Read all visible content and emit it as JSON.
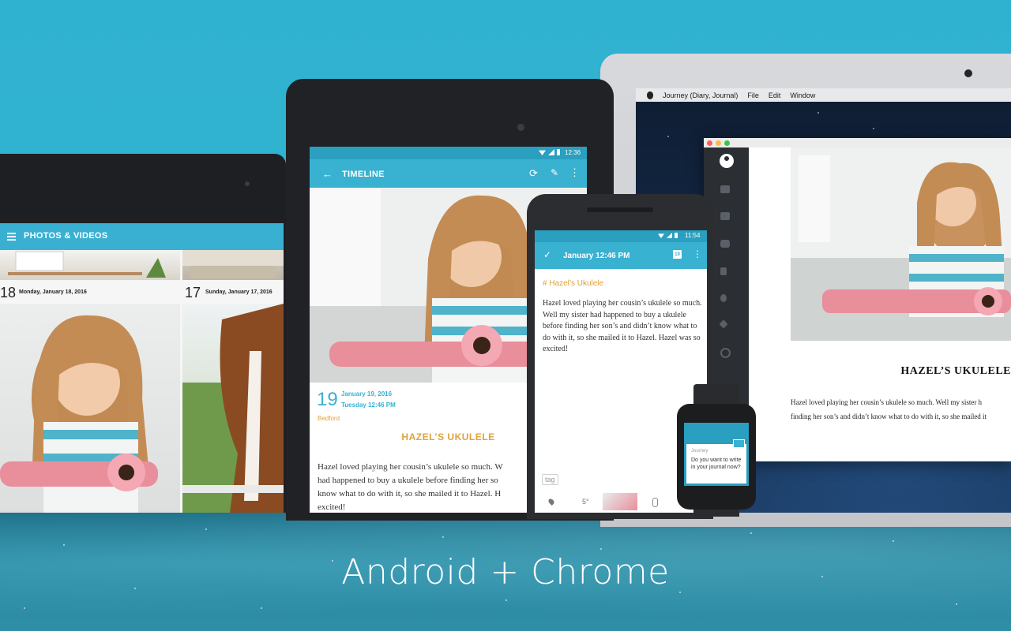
{
  "caption": "Android + Chrome",
  "colors": {
    "accent": "#39b1d1",
    "title_orange": "#e0a23a",
    "background": "#2fb0cf"
  },
  "mac": {
    "menu": [
      "Journey (Diary, Journal)",
      "File",
      "Edit",
      "Window"
    ],
    "sidebar_icons": [
      "profile-icon",
      "folder-icon",
      "calendar-icon",
      "camera-icon",
      "flag-icon",
      "bulb-icon",
      "tag-icon",
      "search-icon"
    ],
    "entry_title": "HAZEL’S UKULELE",
    "entry_body_line1": "Hazel loved playing her cousin’s ukulele so much. Well my sister h",
    "entry_body_line2": "finding her son’s and didn’t know what to do with it, so she mailed it"
  },
  "left_tablet": {
    "title": "PHOTOS & VIDEOS",
    "day1_num": "18",
    "day1_label": "Monday, January 18, 2016",
    "day2_num": "17",
    "day2_label": "Sunday, January 17, 2016"
  },
  "mid_tablet": {
    "time": "12:36",
    "title": "TIMELINE",
    "day_num": "19",
    "date_line1": "January 19, 2016",
    "date_line2": "Tuesday 12:46 PM",
    "place": "Bedford",
    "entry_title": "HAZEL’S UKULELE",
    "body_lines": [
      "Hazel loved playing her cousin’s ukulele so much. W",
      "had happened to buy a ukulele before finding her so",
      "know what to do with it, so she mailed it to Hazel. H",
      "excited!"
    ]
  },
  "phone": {
    "time": "11:54",
    "title": "January 12:46 PM",
    "calendar_badge": "19",
    "hashtag": "# Hazel’s Ukulele",
    "body": "Hazel loved playing her cousin’s ukulele so much. Well my sister had happened to buy a ukulele before finding her son’s and didn’t know what to do with it, so she mailed it to Hazel. Hazel was so excited!",
    "tag_label": "tag",
    "temperature": "5°"
  },
  "watch": {
    "app_name": "Journey",
    "prompt": "Do you want to write in your journal now?"
  }
}
